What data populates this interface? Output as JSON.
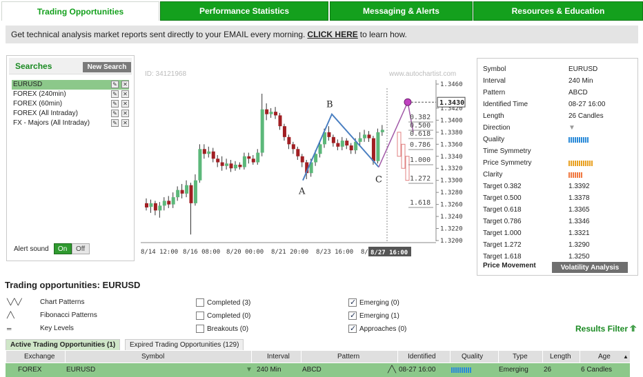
{
  "tabs": [
    {
      "label": "Trading Opportunities",
      "active": true
    },
    {
      "label": "Performance Statistics",
      "active": false
    },
    {
      "label": "Messaging & Alerts",
      "active": false
    },
    {
      "label": "Resources & Education",
      "active": false
    }
  ],
  "banner": {
    "text_before": "Get technical analysis market reports sent directly to your EMAIL every morning.",
    "link": "CLICK HERE",
    "text_after": "to learn how."
  },
  "searches": {
    "title": "Searches",
    "new_search_label": "New Search",
    "items": [
      "EURUSD",
      "FOREX (240min)",
      "FOREX (60min)",
      "FOREX (All Intraday)",
      "FX - Majors (All Intraday)"
    ],
    "alert_sound_label": "Alert sound",
    "on_label": "On",
    "off_label": "Off"
  },
  "chart": {
    "id_label": "ID: 34121968",
    "watermark": "www.autochartist.com",
    "x_ticks": [
      "8/14 12:00",
      "8/16 08:00",
      "8/20 00:00",
      "8/21 20:00",
      "8/23 16:00",
      "8/"
    ],
    "x_highlight": "8/27 16:00",
    "y_ticks": [
      "1.3460",
      "1.3420",
      "1.3400",
      "1.3380",
      "1.3360",
      "1.3340",
      "1.3320",
      "1.3300",
      "1.3280",
      "1.3260",
      "1.3240",
      "1.3220",
      "1.3200"
    ],
    "current_price": "1.3430",
    "fib_labels": [
      "0.382",
      "0.500",
      "0.618",
      "0.786",
      "1.000",
      "1.272",
      "1.618"
    ],
    "point_labels": [
      "A",
      "B",
      "C"
    ],
    "colors": {
      "bull": "#5cb87a",
      "bear": "#a11f23",
      "pattern": "#4a7fc1",
      "projection": "#a25aa8"
    }
  },
  "details": {
    "rows": [
      {
        "key": "Symbol",
        "value": "EURUSD"
      },
      {
        "key": "Interval",
        "value": "240 Min"
      },
      {
        "key": "Pattern",
        "value": "ABCD"
      },
      {
        "key": "Identified Time",
        "value": "08-27 16:00"
      },
      {
        "key": "Length",
        "value": "26 Candles"
      },
      {
        "key": "Direction",
        "value": "▼"
      },
      {
        "key": "Quality",
        "value": ""
      },
      {
        "key": "Time Symmetry",
        "value": ""
      },
      {
        "key": "Price Symmetry",
        "value": ""
      },
      {
        "key": "Clarity",
        "value": ""
      },
      {
        "key": "Target 0.382",
        "value": "1.3392"
      },
      {
        "key": "Target 0.500",
        "value": "1.3378"
      },
      {
        "key": "Target 0.618",
        "value": "1.3365"
      },
      {
        "key": "Target 0.786",
        "value": "1.3346"
      },
      {
        "key": "Target 1.000",
        "value": "1.3321"
      },
      {
        "key": "Target 1.272",
        "value": "1.3290"
      },
      {
        "key": "Target 1.618",
        "value": "1.3250"
      }
    ],
    "price_movement_label": "Price Movement",
    "volatility_label": "Volatility Analysis",
    "quality_color": "#2a8ad8",
    "price_symmetry_color": "#e8a020",
    "clarity_color": "#f07840"
  },
  "section_title": "Trading opportunities: EURUSD",
  "pattern_types": [
    {
      "label": "Chart Patterns",
      "icon": "chart-patterns-icon"
    },
    {
      "label": "Fibonacci Patterns",
      "icon": "fibonacci-icon"
    },
    {
      "label": "Key Levels",
      "icon": "key-levels-icon"
    }
  ],
  "filters_col1": [
    {
      "label": "Completed (3)",
      "checked": false
    },
    {
      "label": "Completed (0)",
      "checked": false
    },
    {
      "label": "Breakouts (0)",
      "checked": false
    }
  ],
  "filters_col2": [
    {
      "label": "Emerging (0)",
      "checked": true
    },
    {
      "label": "Emerging (1)",
      "checked": true
    },
    {
      "label": "Approaches (0)",
      "checked": true
    }
  ],
  "results_filter": "Results Filter",
  "subtabs": [
    "Active Trading Opportunities (1)",
    "Expired Trading Opportunities (129)"
  ],
  "table": {
    "columns": [
      "Exchange",
      "Symbol",
      "Interval",
      "Pattern",
      "Identified",
      "Quality",
      "Type",
      "Length",
      "Age"
    ],
    "rows": [
      {
        "exchange": "FOREX",
        "symbol": "EURUSD",
        "interval": "240 Min",
        "pattern": "ABCD",
        "identified": "08-27 16:00",
        "type": "Emerging",
        "length": "26",
        "age": "6 Candles"
      }
    ]
  }
}
